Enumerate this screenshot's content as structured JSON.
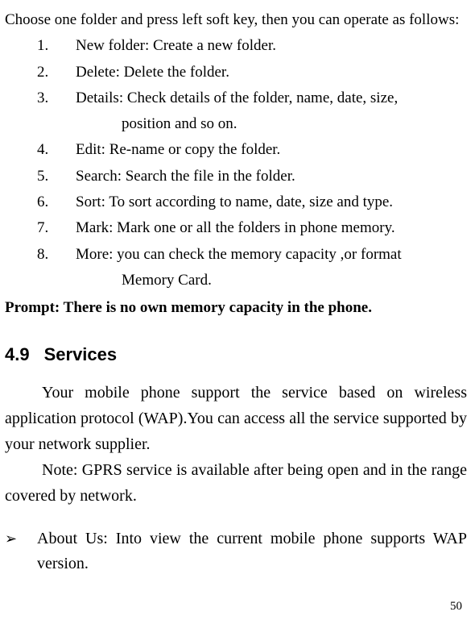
{
  "intro": "Choose one folder and press left soft key, then you can operate as follows:",
  "list": [
    {
      "num": "1.",
      "text": "New folder: Create a new folder."
    },
    {
      "num": "2.",
      "text": "Delete: Delete the folder."
    },
    {
      "num": "3.",
      "text": "Details: Check details of the folder, name, date, size,",
      "cont": "position and so on."
    },
    {
      "num": "4.",
      "text": "Edit: Re-name or copy the folder."
    },
    {
      "num": "5.",
      "text": "Search: Search the file in the folder."
    },
    {
      "num": "6.",
      "text": "Sort: To sort according to name, date, size and type."
    },
    {
      "num": "7.",
      "text": "Mark: Mark one or all the folders in phone memory."
    },
    {
      "num": "8.",
      "text": "More: you can check the memory capacity ,or format",
      "cont": "Memory Card."
    }
  ],
  "prompt": "Prompt: There is no own memory capacity in the phone.",
  "section": {
    "num": "4.9",
    "title": "Services"
  },
  "para1": "Your mobile phone support the service based on wireless application protocol (WAP).You can access all the service supported by your network supplier.",
  "para2": "Note: GPRS service is available after being open and in the range covered by network.",
  "bullet": {
    "mark": "➢",
    "text": "About Us: Into view the current mobile phone supports WAP version."
  },
  "page_number": "50"
}
